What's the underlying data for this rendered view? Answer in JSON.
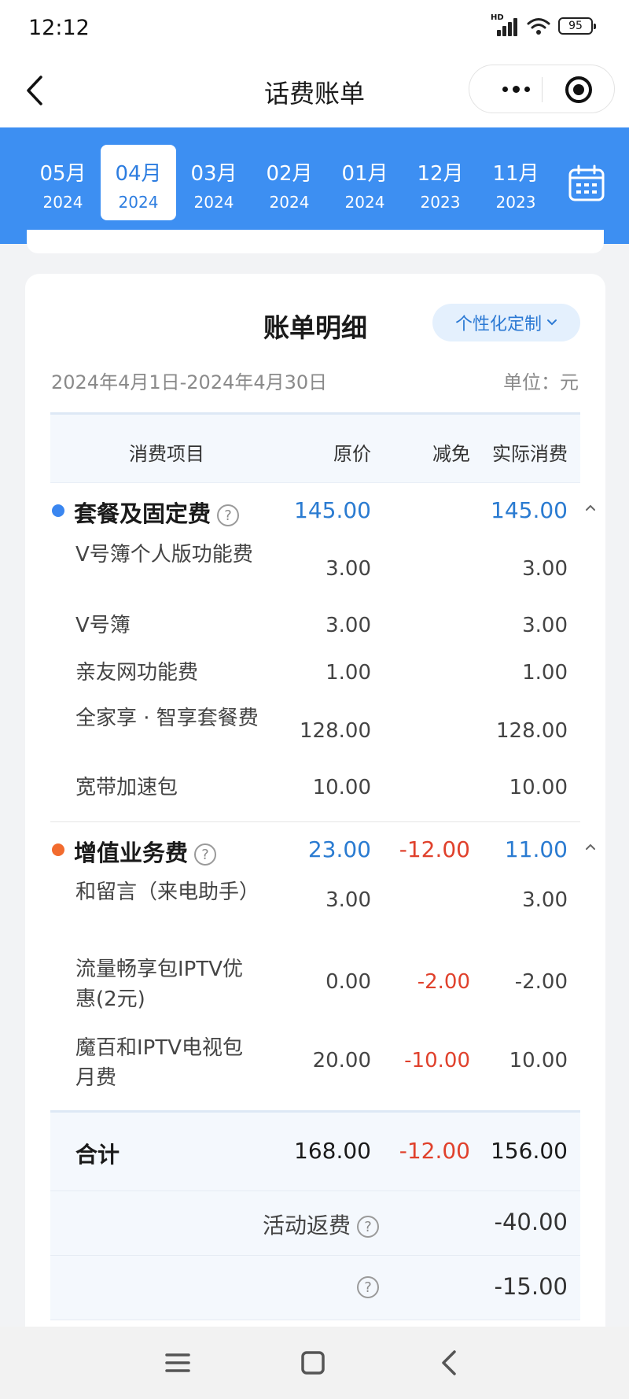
{
  "status_bar": {
    "time": "12:12",
    "signal_label": "HD",
    "battery": "95"
  },
  "nav": {
    "title": "话费账单"
  },
  "months": [
    {
      "month": "05月",
      "year": "2024",
      "active": false
    },
    {
      "month": "04月",
      "year": "2024",
      "active": true
    },
    {
      "month": "03月",
      "year": "2024",
      "active": false
    },
    {
      "month": "02月",
      "year": "2024",
      "active": false
    },
    {
      "month": "01月",
      "year": "2024",
      "active": false
    },
    {
      "month": "12月",
      "year": "2023",
      "active": false
    },
    {
      "month": "11月",
      "year": "2023",
      "active": false
    }
  ],
  "bill": {
    "title": "账单明细",
    "custom_button": "个性化定制",
    "date_range": "2024年4月1日-2024年4月30日",
    "unit": "单位：元",
    "headers": {
      "item": "消费项目",
      "original": "原价",
      "discount": "减免",
      "actual": "实际消费"
    },
    "categories": [
      {
        "name": "套餐及固定费",
        "original": "145.00",
        "discount": "",
        "actual": "145.00",
        "dot_color": "#3a86f0",
        "items": [
          {
            "name": "V号簿个人版功能费",
            "original": "3.00",
            "discount": "",
            "actual": "3.00"
          },
          {
            "name": "V号簿",
            "original": "3.00",
            "discount": "",
            "actual": "3.00"
          },
          {
            "name": "亲友网功能费",
            "original": "1.00",
            "discount": "",
            "actual": "1.00"
          },
          {
            "name": "全家享 · 智享套餐费",
            "original": "128.00",
            "discount": "",
            "actual": "128.00"
          },
          {
            "name": "宽带加速包",
            "original": "10.00",
            "discount": "",
            "actual": "10.00"
          }
        ]
      },
      {
        "name": "增值业务费",
        "original": "23.00",
        "discount": "-12.00",
        "actual": "11.00",
        "dot_color": "#f26b2e",
        "items": [
          {
            "name": "和留言（来电助手）",
            "original": "3.00",
            "discount": "",
            "actual": "3.00"
          },
          {
            "name": "流量畅享包IPTV优惠(2元)",
            "original": "0.00",
            "discount": "-2.00",
            "actual": "-2.00"
          },
          {
            "name": "魔百和IPTV电视包月费",
            "original": "20.00",
            "discount": "-10.00",
            "actual": "10.00"
          }
        ]
      }
    ],
    "total": {
      "label": "合计",
      "original": "168.00",
      "discount": "-12.00",
      "actual": "156.00"
    },
    "rebates": [
      {
        "label": "活动返费",
        "value": "-40.00"
      },
      {
        "label": "",
        "value": "-15.00"
      }
    ]
  },
  "colors": {
    "brand_blue": "#3d8ff2",
    "value_blue": "#2a7bd1",
    "discount_red": "#e0412c"
  }
}
